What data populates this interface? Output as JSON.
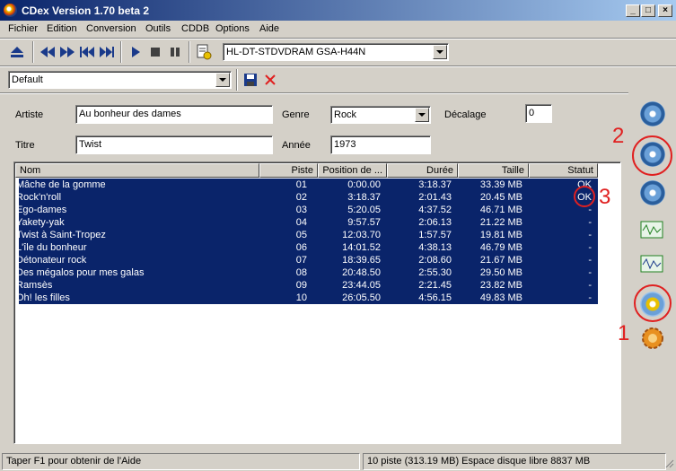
{
  "window": {
    "title": "CDex Version 1.70 beta 2"
  },
  "menu": [
    "Fichier",
    "Edition",
    "Conversion",
    "Outils",
    "CDDB",
    "Options",
    "Aide"
  ],
  "toolbar": {
    "drive": "HL-DT-STDVDRAM GSA-H44N"
  },
  "profile": {
    "value": "Default"
  },
  "info": {
    "artist_label": "Artiste",
    "artist_value": "Au bonheur des dames",
    "genre_label": "Genre",
    "genre_value": "Rock",
    "offset_label": "Décalage",
    "offset_value": "0",
    "title_label": "Titre",
    "title_value": "Twist",
    "year_label": "Année",
    "year_value": "1973"
  },
  "table": {
    "headers": [
      "Nom",
      "Piste",
      "Position de ...",
      "Durée",
      "Taille",
      "Statut"
    ],
    "rows": [
      [
        "Mâche de la gomme",
        "01",
        "0:00.00",
        "3:18.37",
        "33.39 MB",
        "OK"
      ],
      [
        "Rock'n'roll",
        "02",
        "3:18.37",
        "2:01.43",
        "20.45 MB",
        "OK"
      ],
      [
        "Ego-dames",
        "03",
        "5:20.05",
        "4:37.52",
        "46.71 MB",
        "-"
      ],
      [
        "Yakety-yak",
        "04",
        "9:57.57",
        "2:06.13",
        "21.22 MB",
        "-"
      ],
      [
        "Twist à Saint-Tropez",
        "05",
        "12:03.70",
        "1:57.57",
        "19.81 MB",
        "-"
      ],
      [
        "L'île du bonheur",
        "06",
        "14:01.52",
        "4:38.13",
        "46.79 MB",
        "-"
      ],
      [
        "Détonateur rock",
        "07",
        "18:39.65",
        "2:08.60",
        "21.67 MB",
        "-"
      ],
      [
        "Des mégalos pour mes galas",
        "08",
        "20:48.50",
        "2:55.30",
        "29.50 MB",
        "-"
      ],
      [
        "Ramsès",
        "09",
        "23:44.05",
        "2:21.45",
        "23.82 MB",
        "-"
      ],
      [
        "Oh! les filles",
        "10",
        "26:05.50",
        "4:56.15",
        "49.83 MB",
        "-"
      ]
    ]
  },
  "annotations": {
    "n1": "1",
    "n2": "2",
    "n3": "3"
  },
  "status": {
    "help": "Taper F1 pour obtenir de l'Aide",
    "summary": "10 piste (313.19 MB) Espace disque libre   8837 MB"
  },
  "colors": {
    "selection": "#0a246a",
    "annotation": "#e02020",
    "titlebar": "#0a246a"
  }
}
